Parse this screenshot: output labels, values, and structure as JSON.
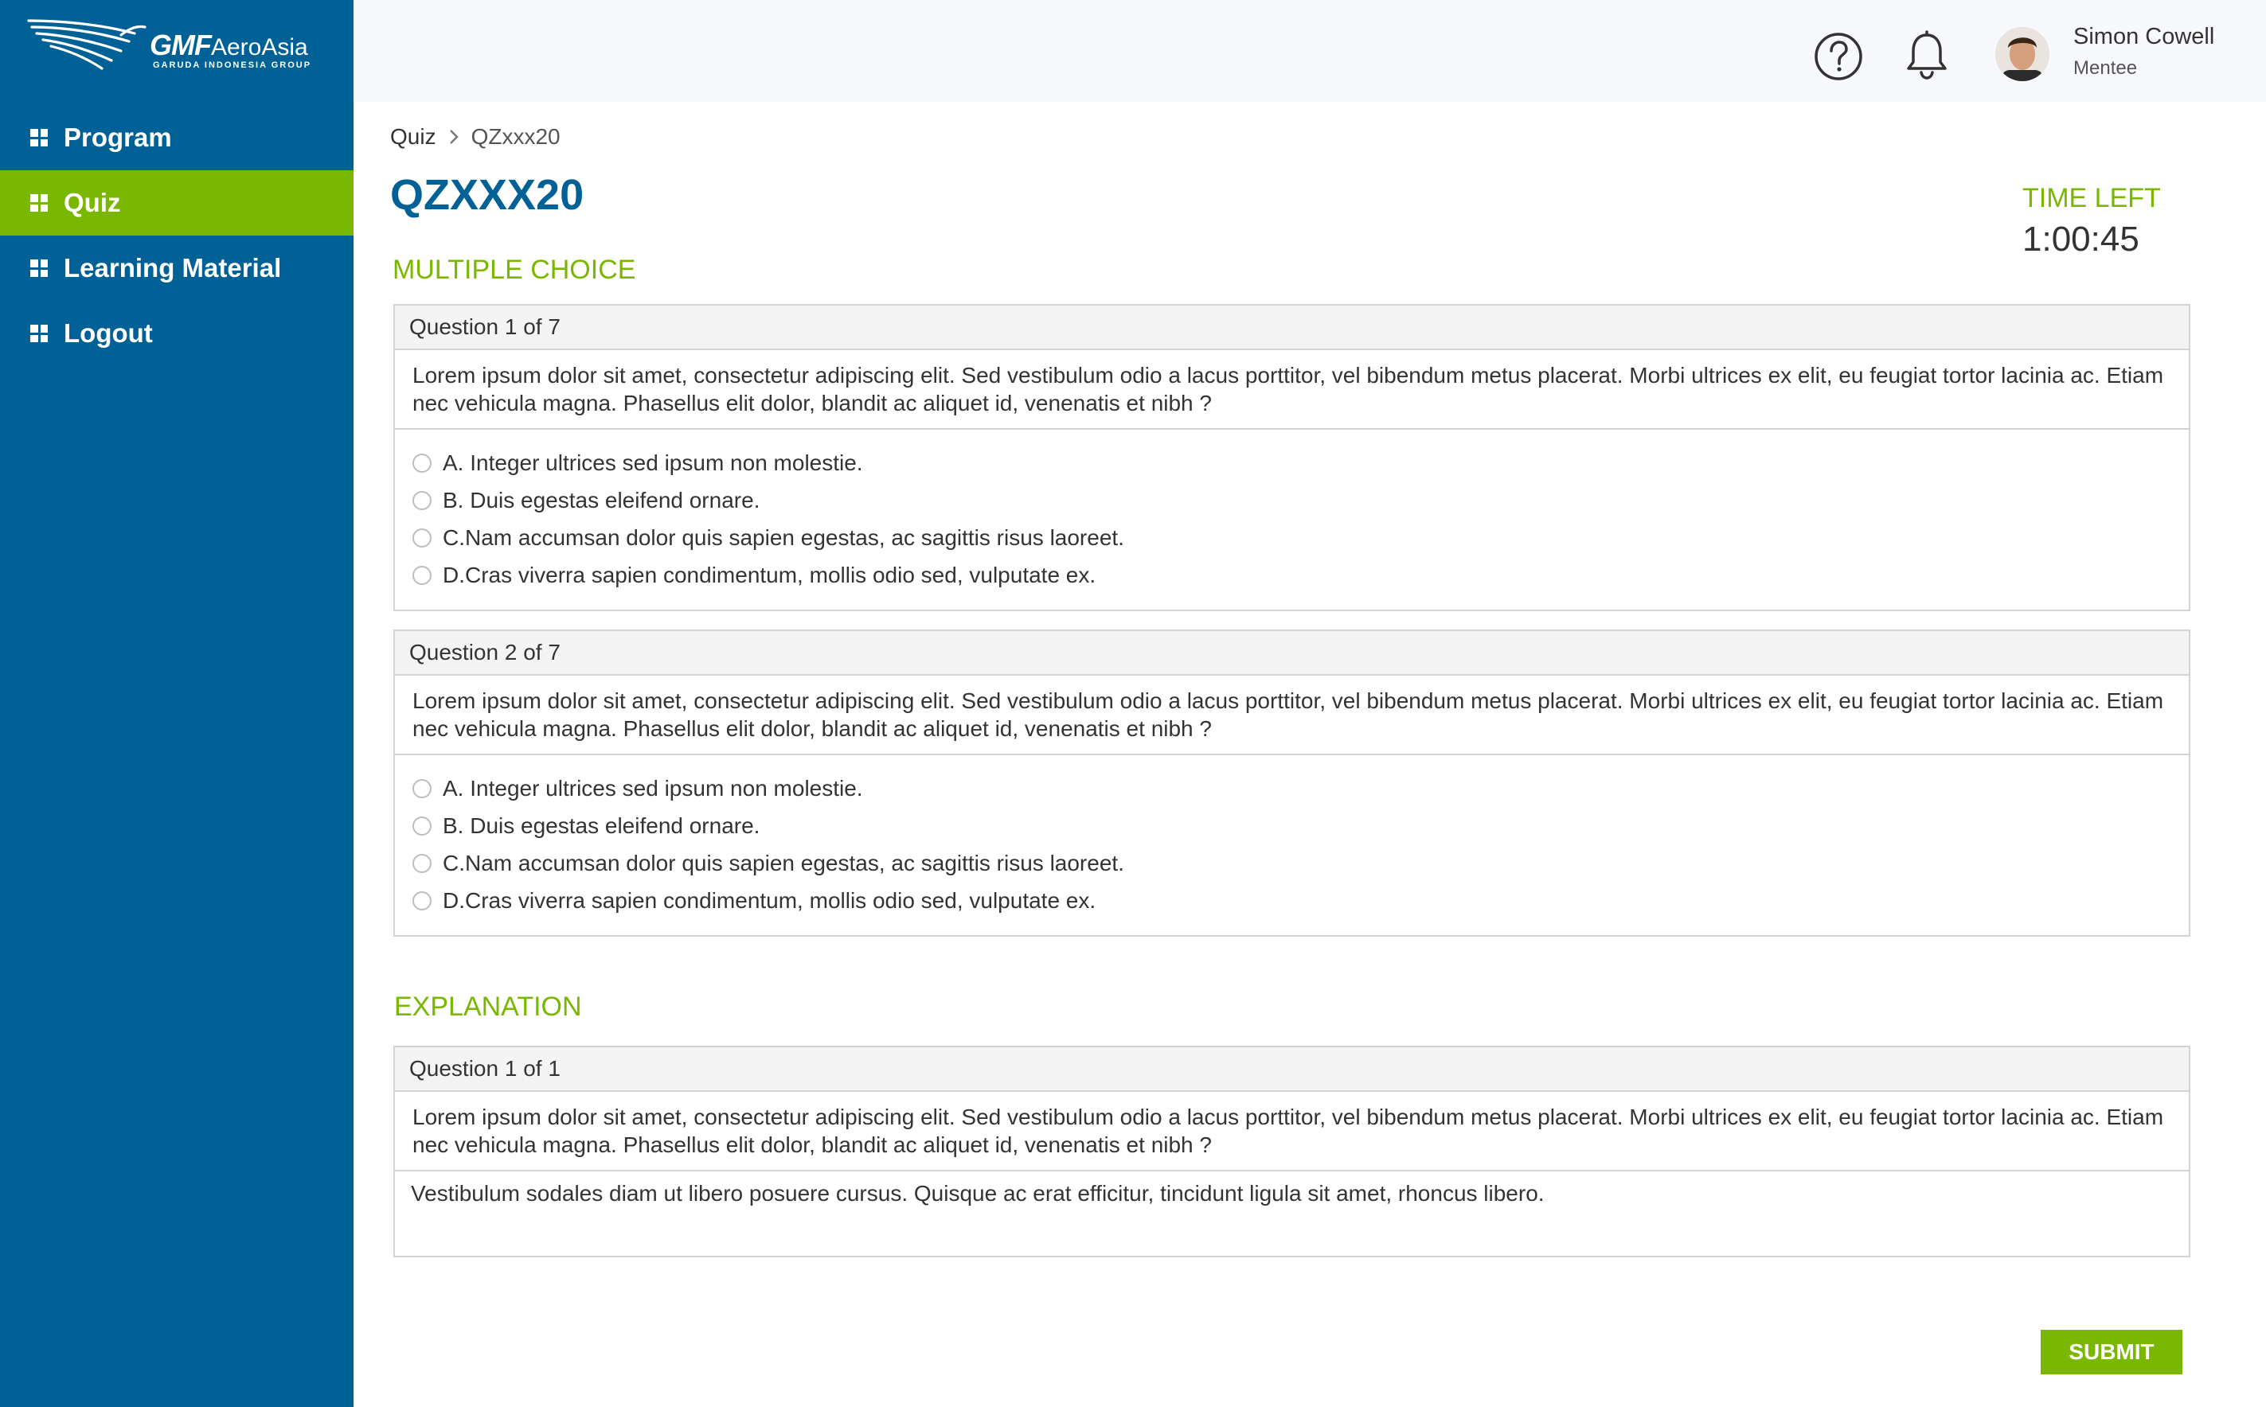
{
  "logo": {
    "brand_main": "GMF",
    "brand_sub": "AeroAsia",
    "tagline": "GARUDA INDONESIA GROUP"
  },
  "sidebar": {
    "items": [
      {
        "label": "Program",
        "icon": "grid-icon",
        "active": false
      },
      {
        "label": "Quiz",
        "icon": "grid-icon",
        "active": true
      },
      {
        "label": "Learning Material",
        "icon": "grid-icon",
        "active": false
      },
      {
        "label": "Logout",
        "icon": "grid-icon",
        "active": false
      }
    ]
  },
  "header": {
    "user_name": "Simon Cowell",
    "user_role": "Mentee",
    "icons": [
      "help-icon",
      "bell-icon"
    ]
  },
  "breadcrumb": {
    "root": "Quiz",
    "current": "QZxxx20"
  },
  "page": {
    "title": "QZXXX20",
    "time_label": "TIME LEFT",
    "time_value": "1:00:45",
    "section_mc": "MULTIPLE CHOICE",
    "section_explanation": "EXPLANATION"
  },
  "questions": [
    {
      "header": "Question 1 of 7",
      "text": "Lorem ipsum dolor sit amet, consectetur adipiscing elit. Sed vestibulum odio a lacus porttitor, vel bibendum metus placerat. Morbi ultrices ex elit, eu feugiat tortor lacinia ac. Etiam nec vehicula magna. Phasellus elit dolor, blandit ac aliquet id, venenatis et nibh ?",
      "options": [
        "A. Integer ultrices sed ipsum non molestie.",
        "B. Duis egestas eleifend ornare.",
        "C.Nam accumsan dolor quis sapien egestas, ac sagittis risus laoreet.",
        "D.Cras viverra sapien condimentum, mollis odio sed, vulputate ex."
      ]
    },
    {
      "header": "Question 2 of 7",
      "text": "Lorem ipsum dolor sit amet, consectetur adipiscing elit. Sed vestibulum odio a lacus porttitor, vel bibendum metus placerat. Morbi ultrices ex elit, eu feugiat tortor lacinia ac. Etiam nec vehicula magna. Phasellus elit dolor, blandit ac aliquet id, venenatis et nibh ?",
      "options": [
        "A. Integer ultrices sed ipsum non molestie.",
        "B. Duis egestas eleifend ornare.",
        "C.Nam accumsan dolor quis sapien egestas, ac sagittis risus laoreet.",
        "D.Cras viverra sapien condimentum, mollis odio sed, vulputate ex."
      ]
    }
  ],
  "explanation": {
    "header": "Question 1 of 1",
    "text": "Lorem ipsum dolor sit amet, consectetur adipiscing elit. Sed vestibulum odio a lacus porttitor, vel bibendum metus placerat. Morbi ultrices ex elit, eu feugiat tortor lacinia ac. Etiam nec vehicula magna. Phasellus elit dolor, blandit ac aliquet id, venenatis et nibh ?",
    "answer": "Vestibulum sodales diam ut libero posuere cursus. Quisque ac erat efficitur, tincidunt ligula sit amet, rhoncus libero."
  },
  "actions": {
    "submit_label": "SUBMIT"
  },
  "colors": {
    "sidebar": "#006197",
    "accent": "#7ab700",
    "title": "#006197"
  }
}
